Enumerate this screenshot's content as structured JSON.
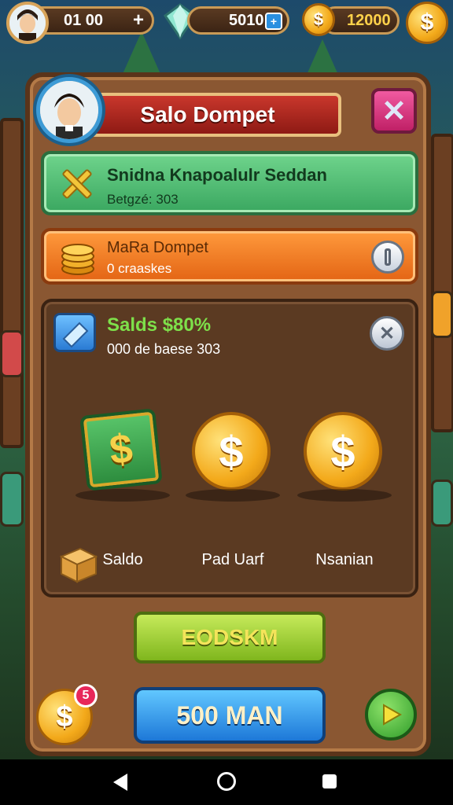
{
  "hud": {
    "lives": "01 00",
    "gems": "5010",
    "coins": "12000"
  },
  "panel": {
    "title": "Salo Dompet",
    "close_icon": "close-x",
    "row1": {
      "title": "Snidna Knapoalulr Seddan",
      "subtitle": "Betgzé: 303"
    },
    "row2": {
      "title": "MaRa Dompet",
      "subtitle": "0 craaskes"
    },
    "inner": {
      "title": "Salds $80%",
      "subtitle": "000 de baese 303",
      "rewards": [
        {
          "label": "Saldo",
          "icon": "cash-icon"
        },
        {
          "label": "Pad Uarf",
          "icon": "coin-icon"
        },
        {
          "label": "Nsanian",
          "icon": "coin-icon"
        }
      ]
    },
    "green_button": "EODSKM",
    "blue_button": "500 MAN",
    "badge_count": "5"
  },
  "colors": {
    "title_red": "#c9372c",
    "green_row": "#3aa760",
    "orange_row": "#e36414",
    "gold": "#f3a91a"
  }
}
